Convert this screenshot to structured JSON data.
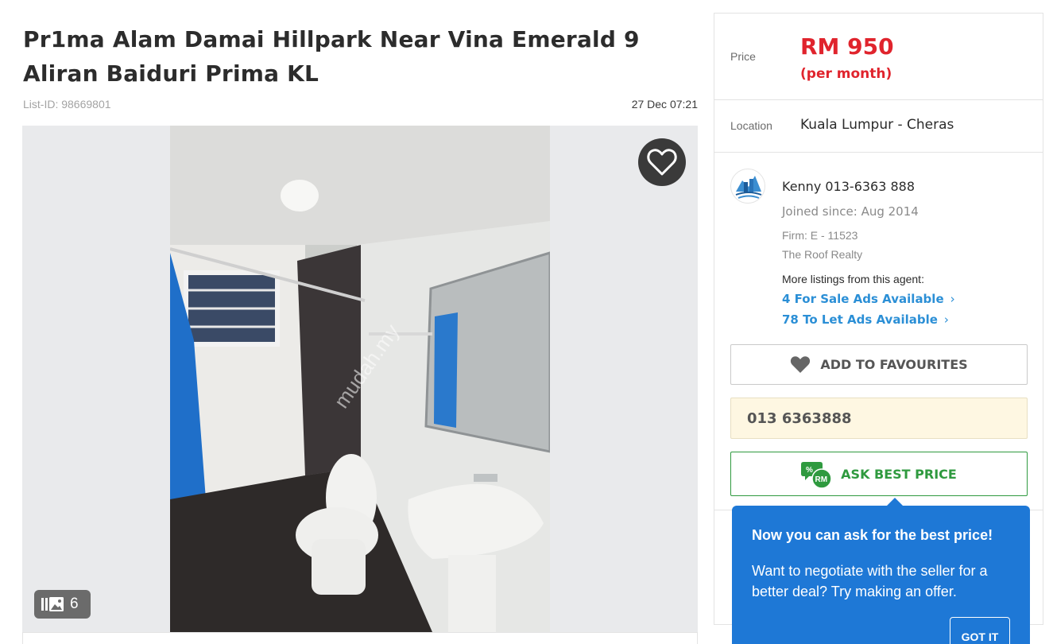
{
  "listing": {
    "title": "Pr1ma Alam Damai Hillpark Near Vina Emerald 9 Aliran Baiduri Prima KL",
    "list_id": "List-ID: 98669801",
    "posted": "27 Dec 07:21"
  },
  "gallery": {
    "photo_count": "6",
    "watermark": "mudah.my"
  },
  "details": {
    "price_label": "Price",
    "price_value": "RM 950",
    "price_unit": "(per month)",
    "location_label": "Location",
    "location_value": "Kuala Lumpur - Cheras"
  },
  "agent": {
    "name": "Kenny 013-6363 888",
    "joined": "Joined since: Aug 2014",
    "firm": "Firm: E - 11523",
    "company": "The Roof Realty",
    "more_listings": "More listings from this agent:",
    "for_sale_link": "4 For Sale Ads Available",
    "to_let_link": "78 To Let Ads Available"
  },
  "actions": {
    "add_favourites": "ADD TO FAVOURITES",
    "phone": "013 6363888",
    "ask_best_price": "ASK BEST PRICE"
  },
  "tooltip": {
    "title": "Now you can ask for the best price!",
    "body": "Want to negotiate with the seller for a better deal? Try making an offer.",
    "button": "GOT IT"
  },
  "colors": {
    "price": "#e0242d",
    "link": "#2b8fd6",
    "ask_green": "#2f9a3f",
    "tooltip_blue": "#1e78d6",
    "phone_bg": "#fef7e2"
  }
}
